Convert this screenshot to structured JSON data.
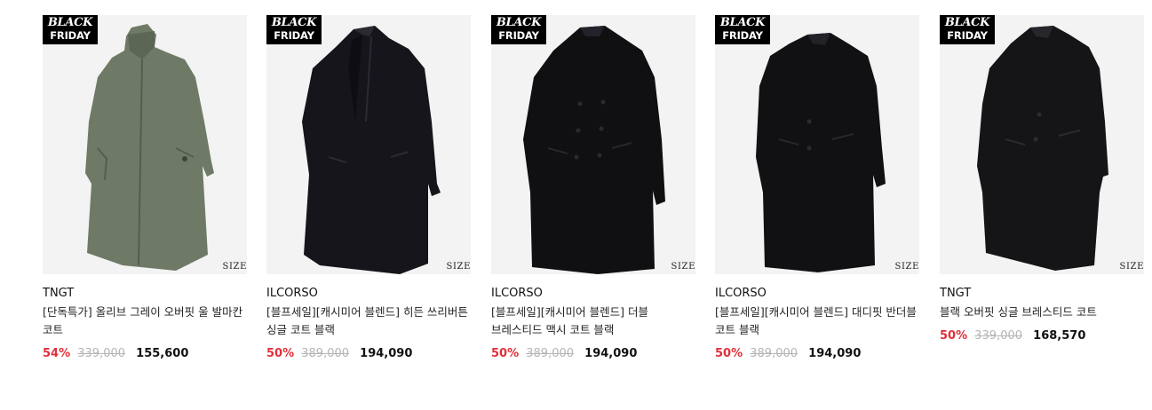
{
  "badge": {
    "line1": "BLACK",
    "line2": "FRIDAY"
  },
  "size_label": "SIZE",
  "colors": {
    "discount": "#e0303a",
    "original_price": "#b5b5b5",
    "olive_coat": "#6f7a66",
    "black_coat": "#151515",
    "thumb_bg": "#f3f3f3"
  },
  "products": [
    {
      "brand": "TNGT",
      "title": "[단독특가] 올리브 그레이 오버핏 울 발마칸 코트",
      "discount": "54%",
      "original_price": "339,000",
      "sale_price": "155,600",
      "coat_color": "olive"
    },
    {
      "brand": "ILCORSO",
      "title": "[블프세일][캐시미어 블렌드] 히든 쓰리버튼 싱글 코트 블랙",
      "discount": "50%",
      "original_price": "389,000",
      "sale_price": "194,090",
      "coat_color": "black"
    },
    {
      "brand": "ILCORSO",
      "title": "[블프세일][캐시미어 블렌드] 더블 브레스티드 맥시 코트 블랙",
      "discount": "50%",
      "original_price": "389,000",
      "sale_price": "194,090",
      "coat_color": "black"
    },
    {
      "brand": "ILCORSO",
      "title": "[블프세일][캐시미어 블렌드] 대디핏 반더블 코트 블랙",
      "discount": "50%",
      "original_price": "389,000",
      "sale_price": "194,090",
      "coat_color": "black"
    },
    {
      "brand": "TNGT",
      "title": "블랙 오버핏 싱글 브레스티드 코트",
      "discount": "50%",
      "original_price": "339,000",
      "sale_price": "168,570",
      "coat_color": "black"
    }
  ]
}
